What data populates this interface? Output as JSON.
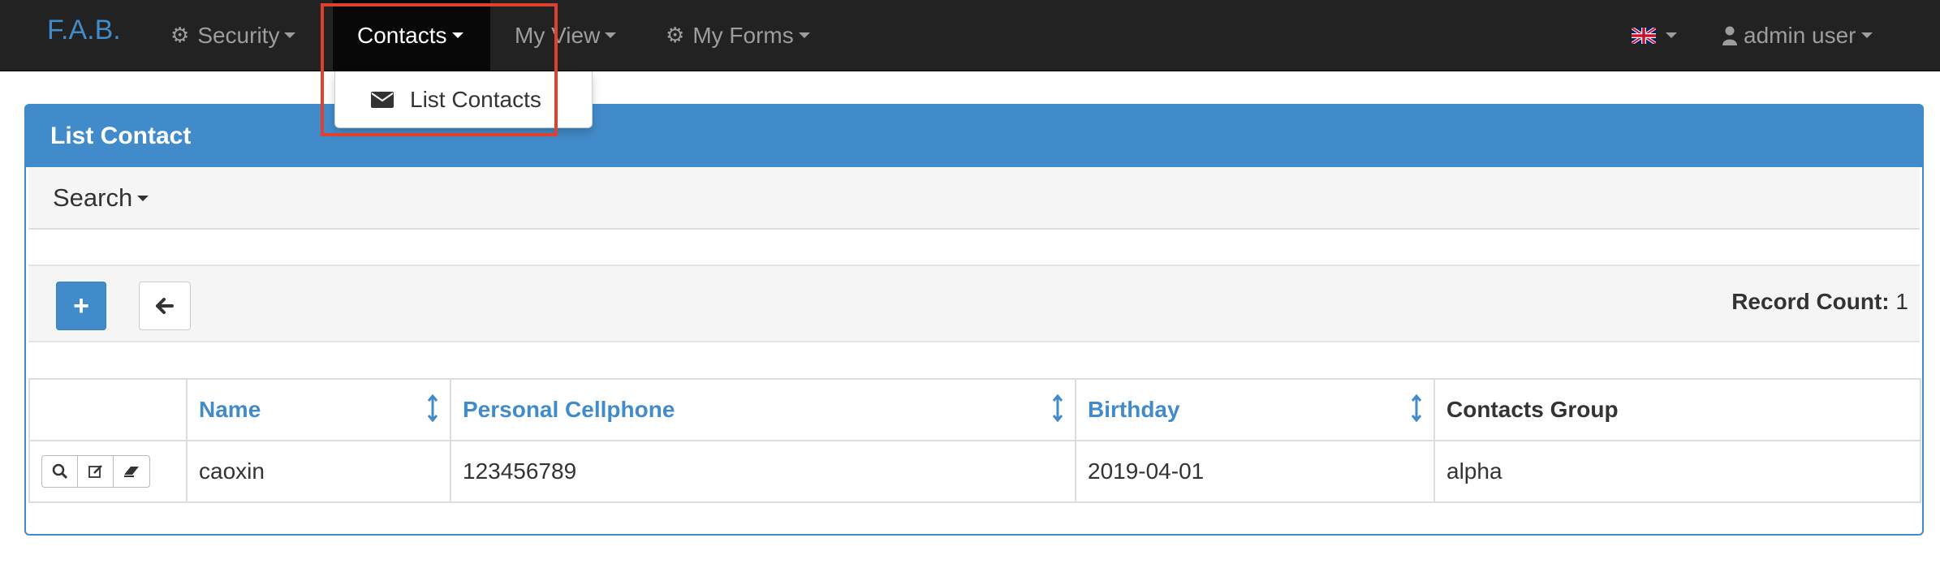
{
  "navbar": {
    "brand": "F.A.B.",
    "items": [
      {
        "label": "Security",
        "icon": "gears-icon"
      },
      {
        "label": "Contacts"
      },
      {
        "label": "My View"
      },
      {
        "label": "My Forms",
        "icon": "gears-icon"
      }
    ],
    "language_icon": "uk-flag-icon",
    "user": {
      "label": "admin user",
      "icon": "user-icon"
    }
  },
  "dropdown": {
    "items": [
      {
        "label": "List Contacts",
        "icon": "envelope-icon"
      }
    ]
  },
  "panel": {
    "title": "List Contact",
    "search_label": "Search",
    "record_count_label": "Record Count:",
    "record_count_value": "1"
  },
  "table": {
    "columns": [
      "Name",
      "Personal Cellphone",
      "Birthday",
      "Contacts Group"
    ],
    "rows": [
      {
        "name": "caoxin",
        "cellphone": "123456789",
        "birthday": "2019-04-01",
        "group": "alpha"
      }
    ]
  },
  "colors": {
    "primary": "#428bca",
    "navbar": "#222222",
    "highlight": "#e0412e"
  }
}
